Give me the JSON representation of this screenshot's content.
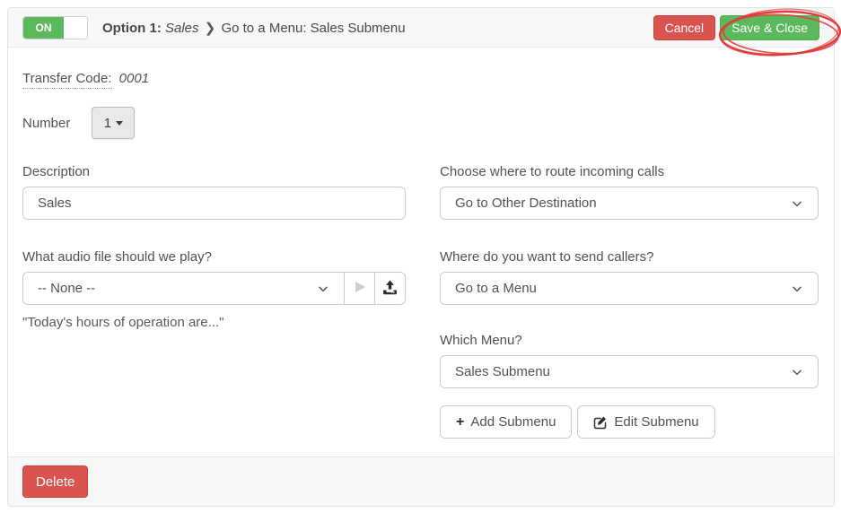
{
  "header": {
    "toggle_state": "ON",
    "title_prefix": "Option 1:",
    "title_name": "Sales",
    "title_separator": "❯",
    "title_rest": "Go to a Menu: Sales Submenu",
    "cancel_label": "Cancel",
    "save_label": "Save & Close"
  },
  "form": {
    "transfer_code_label": "Transfer Code:",
    "transfer_code_value": "0001",
    "number_label": "Number",
    "number_value": "1",
    "description_label": "Description",
    "description_value": "Sales",
    "audio_label": "What audio file should we play?",
    "audio_value": "-- None --",
    "audio_hint": "\"Today's hours of operation are...\"",
    "route_label": "Choose where to route incoming calls",
    "route_value": "Go to Other Destination",
    "send_label": "Where do you want to send callers?",
    "send_value": "Go to a Menu",
    "menu_label": "Which Menu?",
    "menu_value": "Sales Submenu",
    "add_submenu_label": "Add Submenu",
    "add_submenu_icon": "+",
    "edit_submenu_label": "Edit Submenu"
  },
  "footer": {
    "delete_label": "Delete"
  },
  "colors": {
    "success_green": "#5cb85c",
    "danger_red": "#d9534f",
    "annotation_red": "#e23b3b",
    "bar_gray": "#f7f7f7"
  },
  "icons": {
    "select_chevron": "chevron-down",
    "number_caret": "caret-down",
    "play": "play-triangle",
    "upload": "upload-arrow-tray",
    "add": "plus",
    "edit": "pencil-square",
    "annotation": "hand-drawn-red-ellipse"
  }
}
